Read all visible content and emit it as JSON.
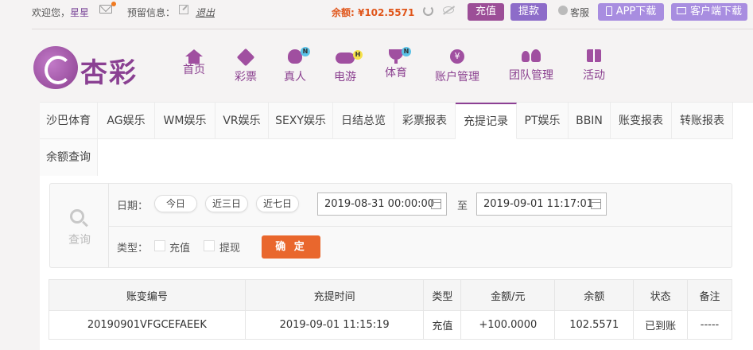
{
  "topbar": {
    "welcome": "欢迎您，",
    "username": "星星",
    "notice_label": "预留信息：",
    "logout": "退出",
    "balance": "余额: ¥102.5571",
    "recharge": "充值",
    "withdraw": "提款",
    "service": "客服",
    "app_download": "APP下载",
    "client_download": "客户端下载"
  },
  "logo": {
    "text": "杏彩"
  },
  "nav": {
    "items": [
      {
        "label": "首页",
        "icon": "home-icon"
      },
      {
        "label": "彩票",
        "icon": "lottery-icon"
      },
      {
        "label": "真人",
        "icon": "live-icon",
        "badge": "N"
      },
      {
        "label": "电游",
        "icon": "gamepad-icon",
        "badge": "H"
      },
      {
        "label": "体育",
        "icon": "trophy-icon",
        "badge": "N"
      },
      {
        "label": "账户管理",
        "icon": "account-icon",
        "glyph": "¥"
      },
      {
        "label": "团队管理",
        "icon": "team-icon"
      },
      {
        "label": "活动",
        "icon": "gift-icon"
      }
    ]
  },
  "tabs": [
    "沙巴体育",
    "AG娱乐",
    "WM娱乐",
    "VR娱乐",
    "SEXY娱乐",
    "日结总览",
    "彩票报表",
    "充提记录",
    "PT娱乐",
    "BBIN",
    "账变报表",
    "转账报表",
    "余额查询"
  ],
  "active_tab": "充提记录",
  "query": {
    "label": "查询",
    "date_label": "日期：",
    "quick_dates": [
      "今日",
      "近三日",
      "近七日"
    ],
    "start_date": "2019-08-31 00:00:00",
    "to": "至",
    "end_date": "2019-09-01 11:17:01",
    "type_label": "类型：",
    "type_recharge": "充值",
    "type_withdraw": "提现",
    "confirm": "确 定"
  },
  "table": {
    "headers": [
      "账变编号",
      "充提时间",
      "类型",
      "金额/元",
      "余额",
      "状态",
      "备注"
    ],
    "rows": [
      [
        "20190901VFGCEFAEEK",
        "2019-09-01 11:15:19",
        "充值",
        "+100.0000",
        "102.5571",
        "已到账",
        "-----"
      ]
    ]
  },
  "colors": {
    "brand": "#8a3f8f",
    "accent": "#e9672d",
    "amount": "#e0261b",
    "success": "#3aa83a"
  }
}
